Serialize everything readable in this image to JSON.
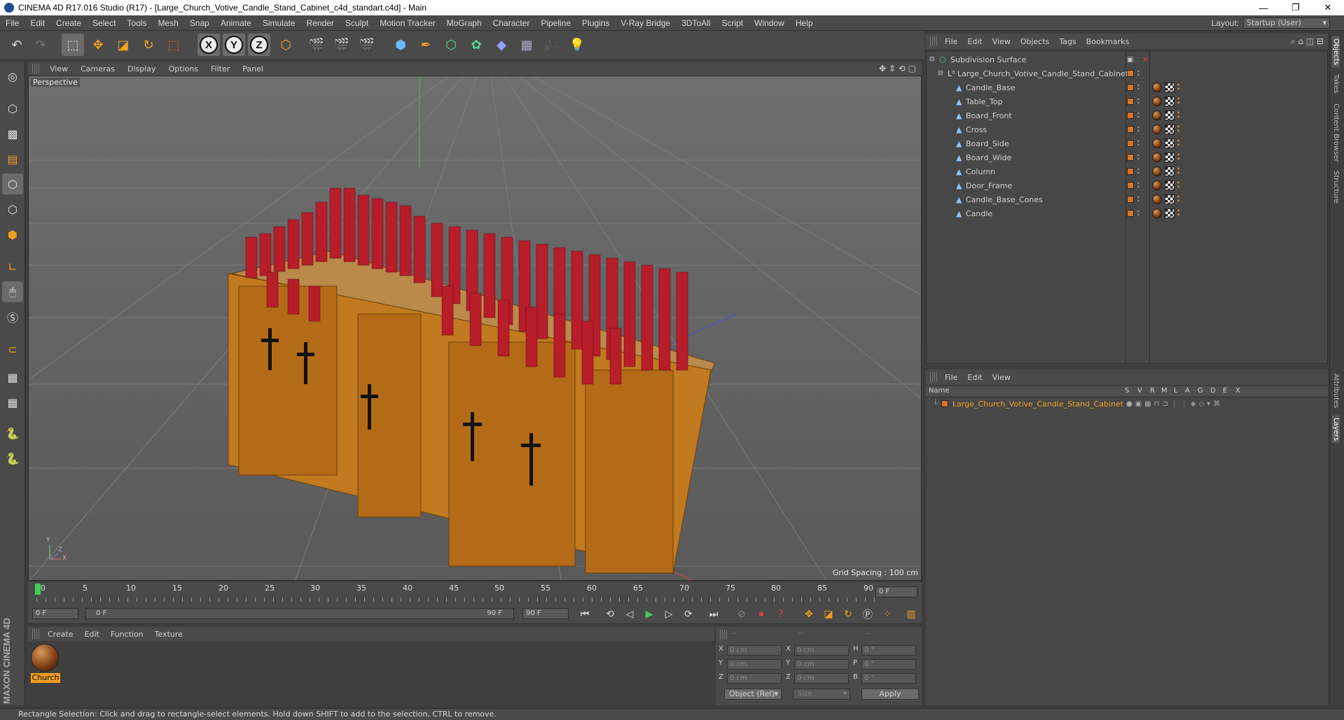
{
  "window": {
    "title": "CINEMA 4D R17.016 Studio (R17) - [Large_Church_Votive_Candle_Stand_Cabinet_c4d_standart.c4d] - Main",
    "controls": [
      "—",
      "❐",
      "✕"
    ]
  },
  "menubar": {
    "items": [
      "File",
      "Edit",
      "Create",
      "Select",
      "Tools",
      "Mesh",
      "Snap",
      "Animate",
      "Simulate",
      "Render",
      "Sculpt",
      "Motion Tracker",
      "MoGraph",
      "Character",
      "Pipeline",
      "Plugins",
      "V-Ray Bridge",
      "3DToAll",
      "Script",
      "Window",
      "Help"
    ],
    "layout_label": "Layout:",
    "layout_value": "Startup (User)"
  },
  "viewport": {
    "menu": [
      "View",
      "Cameras",
      "Display",
      "Options",
      "Filter",
      "Panel"
    ],
    "label": "Perspective",
    "grid_spacing": "Grid Spacing : 100 cm",
    "axis_labels": [
      "Y",
      "Z",
      "X"
    ]
  },
  "timeline": {
    "ticks": [
      "0",
      "5",
      "10",
      "15",
      "20",
      "25",
      "30",
      "35",
      "40",
      "45",
      "50",
      "55",
      "60",
      "65",
      "70",
      "75",
      "80",
      "85",
      "90"
    ],
    "current_frame": "0 F"
  },
  "transport": {
    "start_frame": "0 F",
    "range_start": "0 F",
    "range_end": "90 F",
    "end_frame": "90 F"
  },
  "material_manager": {
    "menu": [
      "Create",
      "Edit",
      "Function",
      "Texture"
    ],
    "materials": [
      {
        "name": "Church"
      }
    ]
  },
  "coordinates": {
    "header": [
      "--",
      "--",
      "--"
    ],
    "rows": [
      {
        "a": "X",
        "av": "0 cm",
        "b": "X",
        "bv": "0 cm",
        "c": "H",
        "cv": "0 °"
      },
      {
        "a": "Y",
        "av": "0 cm",
        "b": "Y",
        "bv": "0 cm",
        "c": "P",
        "cv": "0 °"
      },
      {
        "a": "Z",
        "av": "0 cm",
        "b": "Z",
        "bv": "0 cm",
        "c": "B",
        "cv": "0 °"
      }
    ],
    "mode": "Object (Rel)",
    "size": "Size",
    "apply": "Apply"
  },
  "object_manager": {
    "menu": [
      "File",
      "Edit",
      "View",
      "Objects",
      "Tags",
      "Bookmarks"
    ],
    "objects": [
      {
        "name": "Subdivision Surface",
        "level": 0
      },
      {
        "name": "Large_Church_Votive_Candle_Stand_Cabinet",
        "level": 1
      },
      {
        "name": "Candle_Base",
        "level": 2
      },
      {
        "name": "Table_Top",
        "level": 2
      },
      {
        "name": "Board_Front",
        "level": 2
      },
      {
        "name": "Cross",
        "level": 2
      },
      {
        "name": "Board_Side",
        "level": 2
      },
      {
        "name": "Board_Wide",
        "level": 2
      },
      {
        "name": "Column",
        "level": 2
      },
      {
        "name": "Door_Frame",
        "level": 2
      },
      {
        "name": "Candle_Base_Cones",
        "level": 2
      },
      {
        "name": "Candle",
        "level": 2
      }
    ]
  },
  "layer_manager": {
    "menu": [
      "File",
      "Edit",
      "View"
    ],
    "columns": [
      "Name",
      "S",
      "V",
      "R",
      "M",
      "L",
      "A",
      "G",
      "D",
      "E",
      "X"
    ],
    "layers": [
      {
        "name": "Large_Church_Votive_Candle_Stand_Cabinet",
        "color": "#d8732a"
      }
    ]
  },
  "right_tabs": [
    "Objects",
    "Takes",
    "Content Browser",
    "Structure",
    "Attributes",
    "Layers"
  ],
  "status": "Rectangle Selection: Click and drag to rectangle-select elements. Hold down SHIFT to add to the selection, CTRL to remove.",
  "brand": "MAXON CINEMA 4D",
  "colors": {
    "accent": "#f0a020",
    "layer": "#d8732a",
    "wood": "#c07a1e",
    "candle": "#b81d2a"
  }
}
